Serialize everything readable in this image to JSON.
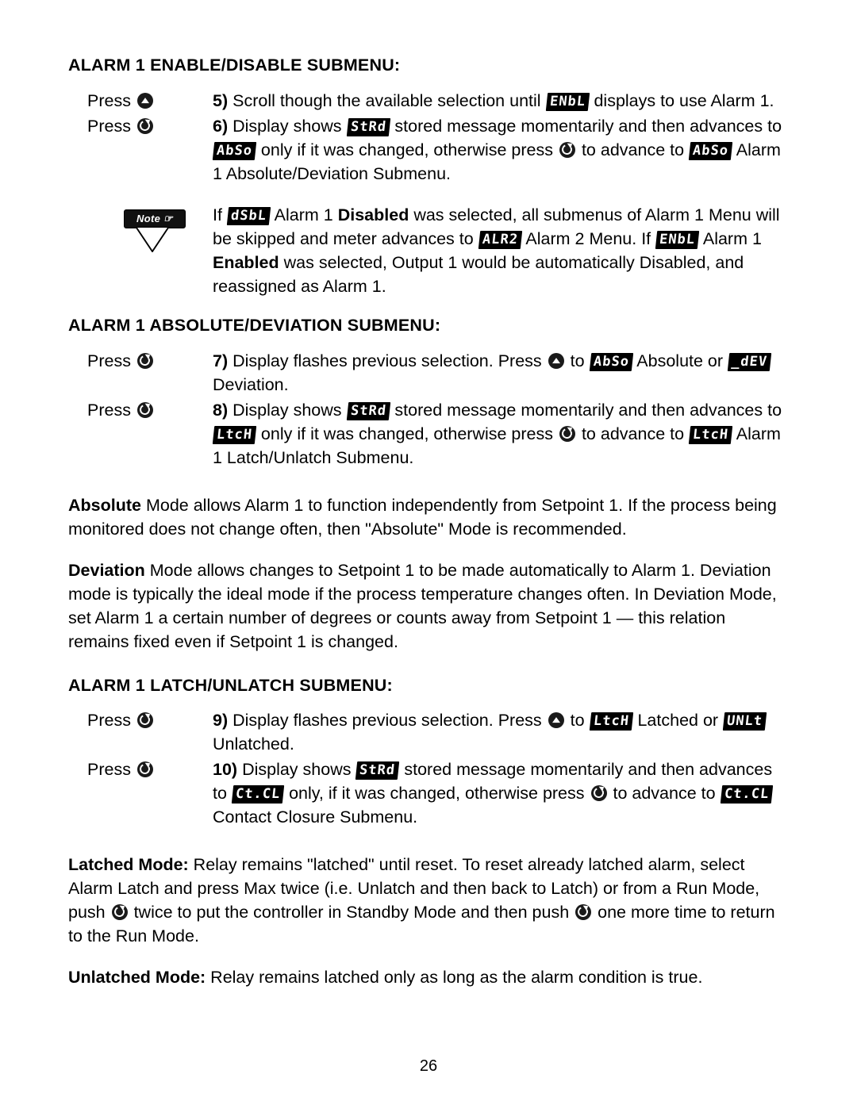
{
  "page": {
    "number": "26"
  },
  "sections": [
    {
      "title": "ALARM 1 ENABLE/DISABLE SUBMENU:",
      "steps": [
        {
          "press_label": "Press",
          "press_icon": "up-arrow-button",
          "num": "5)",
          "text_1": "Scroll though the available selection until ",
          "led_1": "ENbL",
          "text_2": " displays to use Alarm 1."
        },
        {
          "press_label": "Press",
          "press_icon": "loop-arrow-button",
          "num": "6)",
          "text_1": "Display shows ",
          "led_1": "StRd",
          "text_2": " stored message momentarily and then advances to ",
          "led_2": "AbSo",
          "text_3": " only if it was changed, otherwise press ",
          "inline_icon": "loop-arrow-button",
          "text_4": " to advance to ",
          "led_3": "AbSo",
          "text_5": " Alarm 1 Absolute/Deviation Submenu."
        }
      ]
    }
  ],
  "note": {
    "badge_label": "Note",
    "badge_icon": "pointing-hand-icon",
    "text_1": "If ",
    "led_1": "dSbL",
    "text_2": " Alarm 1 ",
    "bold_1": "Disabled",
    "text_3": " was selected, all submenus of Alarm 1 Menu will be skipped and meter advances to ",
    "led_2": "ALR2",
    "text_4": " Alarm 2 Menu. If ",
    "led_3": "ENbL",
    "text_5": " Alarm 1 ",
    "bold_2": "Enabled",
    "text_6": " was selected, Output 1 would be automatically Disabled, and reassigned as Alarm 1."
  },
  "section2": {
    "title": "ALARM 1 ABSOLUTE/DEVIATION SUBMENU:",
    "step7": {
      "press_label": "Press",
      "num": "7)",
      "text_1": "Display flashes previous selection. Press ",
      "inline_icon": "up-arrow-button",
      "text_2": " to ",
      "led_1": "AbSo",
      "text_3": " Absolute or ",
      "led_2": "_dEV",
      "text_4": " Deviation."
    },
    "step8": {
      "press_label": "Press",
      "num": "8)",
      "text_1": "Display shows ",
      "led_1": "StRd",
      "text_2": " stored message momentarily and then advances to ",
      "led_2": "LtcH",
      "text_3": " only if it was changed, otherwise press ",
      "inline_icon": "loop-arrow-button",
      "text_4": " to advance to ",
      "led_3": "LtcH",
      "text_5": " Alarm 1 Latch/Unlatch Submenu."
    }
  },
  "paragraphs": {
    "absolute": {
      "bold": "Absolute",
      "text": " Mode allows Alarm 1 to function independently from Setpoint 1. If the process being monitored does not change often, then \"Absolute\" Mode is recommended."
    },
    "deviation": {
      "bold": "Deviation",
      "text": " Mode allows changes to Setpoint 1 to be made automatically to Alarm 1. Deviation mode is typically the ideal mode if the process temperature changes often. In Deviation Mode, set Alarm 1 a certain number of degrees or counts away from Setpoint 1 — this relation remains fixed even if Setpoint 1 is changed."
    },
    "unlatched": {
      "bold": "Unlatched Mode:",
      "text": " Relay remains latched only as long as the alarm condition is true."
    }
  },
  "section3": {
    "title": "ALARM 1 LATCH/UNLATCH SUBMENU:",
    "step9": {
      "press_label": "Press",
      "num": "9)",
      "text_1": "Display flashes previous selection. Press ",
      "inline_icon": "up-arrow-button",
      "text_2": " to ",
      "led_1": "LtcH",
      "text_3": " Latched or ",
      "led_2": "UNLt",
      "text_4": " Unlatched."
    },
    "step10": {
      "press_label": "Press",
      "num": "10)",
      "text_1": "Display shows ",
      "led_1": "StRd",
      "text_2": " stored message momentarily and then advances to ",
      "led_2": "Ct.CL",
      "text_3": " only, if it was changed, otherwise press ",
      "inline_icon": "loop-arrow-button",
      "text_4": " to advance to ",
      "led_3": "Ct.CL",
      "text_5": " Contact Closure Submenu."
    }
  },
  "latched_paragraph": {
    "bold": "Latched Mode:",
    "text_1": " Relay remains \"latched\" until reset. To reset already latched alarm, select Alarm Latch and press Max twice (i.e. Unlatch and then back to Latch) or from a Run Mode, push ",
    "text_2": " twice to put the controller in Standby Mode and then push ",
    "text_3": " one more time to return to the Run Mode."
  }
}
